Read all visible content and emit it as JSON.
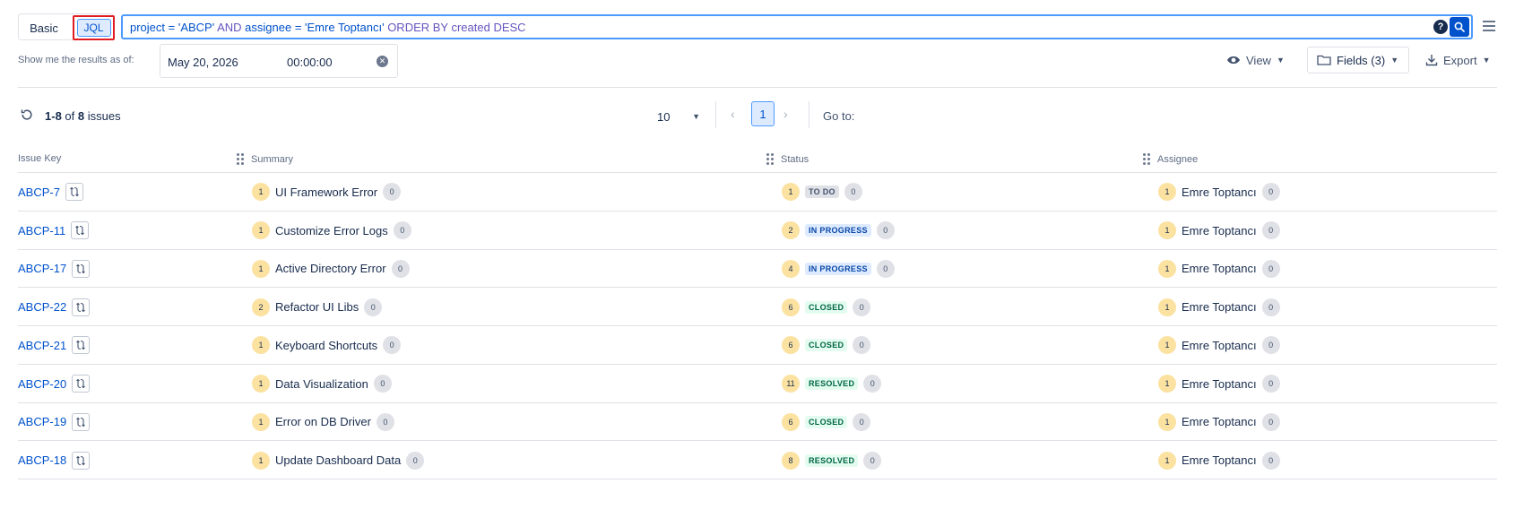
{
  "search": {
    "mode_basic": "Basic",
    "mode_jql": "JQL",
    "jql": {
      "p1": "project = 'ABCP'",
      "p2": " AND ",
      "p3": "assignee = 'Emre Toptancı'",
      "p4": " ORDER BY created DESC"
    },
    "help_glyph": "?"
  },
  "asof": {
    "label": "Show me the results as of:",
    "date": "May 20, 2026",
    "time": "00:00:00"
  },
  "actions": {
    "view": "View",
    "fields": "Fields (3)",
    "export": "Export"
  },
  "results": {
    "range_start": "1",
    "range_sep": "-",
    "range_end": "8",
    "of": " of ",
    "total": "8",
    "suffix": " issues"
  },
  "pager": {
    "page_size": "10",
    "current_page": "1",
    "goto_label": "Go to:"
  },
  "columns": {
    "key": "Issue Key",
    "summary": "Summary",
    "status": "Status",
    "assignee": "Assignee"
  },
  "rows": [
    {
      "key": "ABCP-7",
      "sum_n": "1",
      "summary": "UI Framework Error",
      "sum_c": "0",
      "stat_n": "1",
      "status": "TO DO",
      "stat_type": "todo",
      "stat_c": "0",
      "asg_n": "1",
      "assignee": "Emre Toptancı",
      "asg_c": "0"
    },
    {
      "key": "ABCP-11",
      "sum_n": "1",
      "summary": "Customize Error Logs",
      "sum_c": "0",
      "stat_n": "2",
      "status": "IN PROGRESS",
      "stat_type": "progress",
      "stat_c": "0",
      "asg_n": "1",
      "assignee": "Emre Toptancı",
      "asg_c": "0"
    },
    {
      "key": "ABCP-17",
      "sum_n": "1",
      "summary": "Active Directory Error",
      "sum_c": "0",
      "stat_n": "4",
      "status": "IN PROGRESS",
      "stat_type": "progress",
      "stat_c": "0",
      "asg_n": "1",
      "assignee": "Emre Toptancı",
      "asg_c": "0"
    },
    {
      "key": "ABCP-22",
      "sum_n": "2",
      "summary": "Refactor UI Libs",
      "sum_c": "0",
      "stat_n": "6",
      "status": "CLOSED",
      "stat_type": "done",
      "stat_c": "0",
      "asg_n": "1",
      "assignee": "Emre Toptancı",
      "asg_c": "0"
    },
    {
      "key": "ABCP-21",
      "sum_n": "1",
      "summary": "Keyboard Shortcuts",
      "sum_c": "0",
      "stat_n": "6",
      "status": "CLOSED",
      "stat_type": "done",
      "stat_c": "0",
      "asg_n": "1",
      "assignee": "Emre Toptancı",
      "asg_c": "0"
    },
    {
      "key": "ABCP-20",
      "sum_n": "1",
      "summary": "Data Visualization",
      "sum_c": "0",
      "stat_n": "11",
      "status": "RESOLVED",
      "stat_type": "done",
      "stat_c": "0",
      "asg_n": "1",
      "assignee": "Emre Toptancı",
      "asg_c": "0"
    },
    {
      "key": "ABCP-19",
      "sum_n": "1",
      "summary": "Error on DB Driver",
      "sum_c": "0",
      "stat_n": "6",
      "status": "CLOSED",
      "stat_type": "done",
      "stat_c": "0",
      "asg_n": "1",
      "assignee": "Emre Toptancı",
      "asg_c": "0"
    },
    {
      "key": "ABCP-18",
      "sum_n": "1",
      "summary": "Update Dashboard Data",
      "sum_c": "0",
      "stat_n": "8",
      "status": "RESOLVED",
      "stat_type": "done",
      "stat_c": "0",
      "asg_n": "1",
      "assignee": "Emre Toptancı",
      "asg_c": "0"
    }
  ],
  "colors": {
    "accent": "#0052cc",
    "highlight_border": "#e11b22",
    "count_badge": "#fbe2a1"
  }
}
